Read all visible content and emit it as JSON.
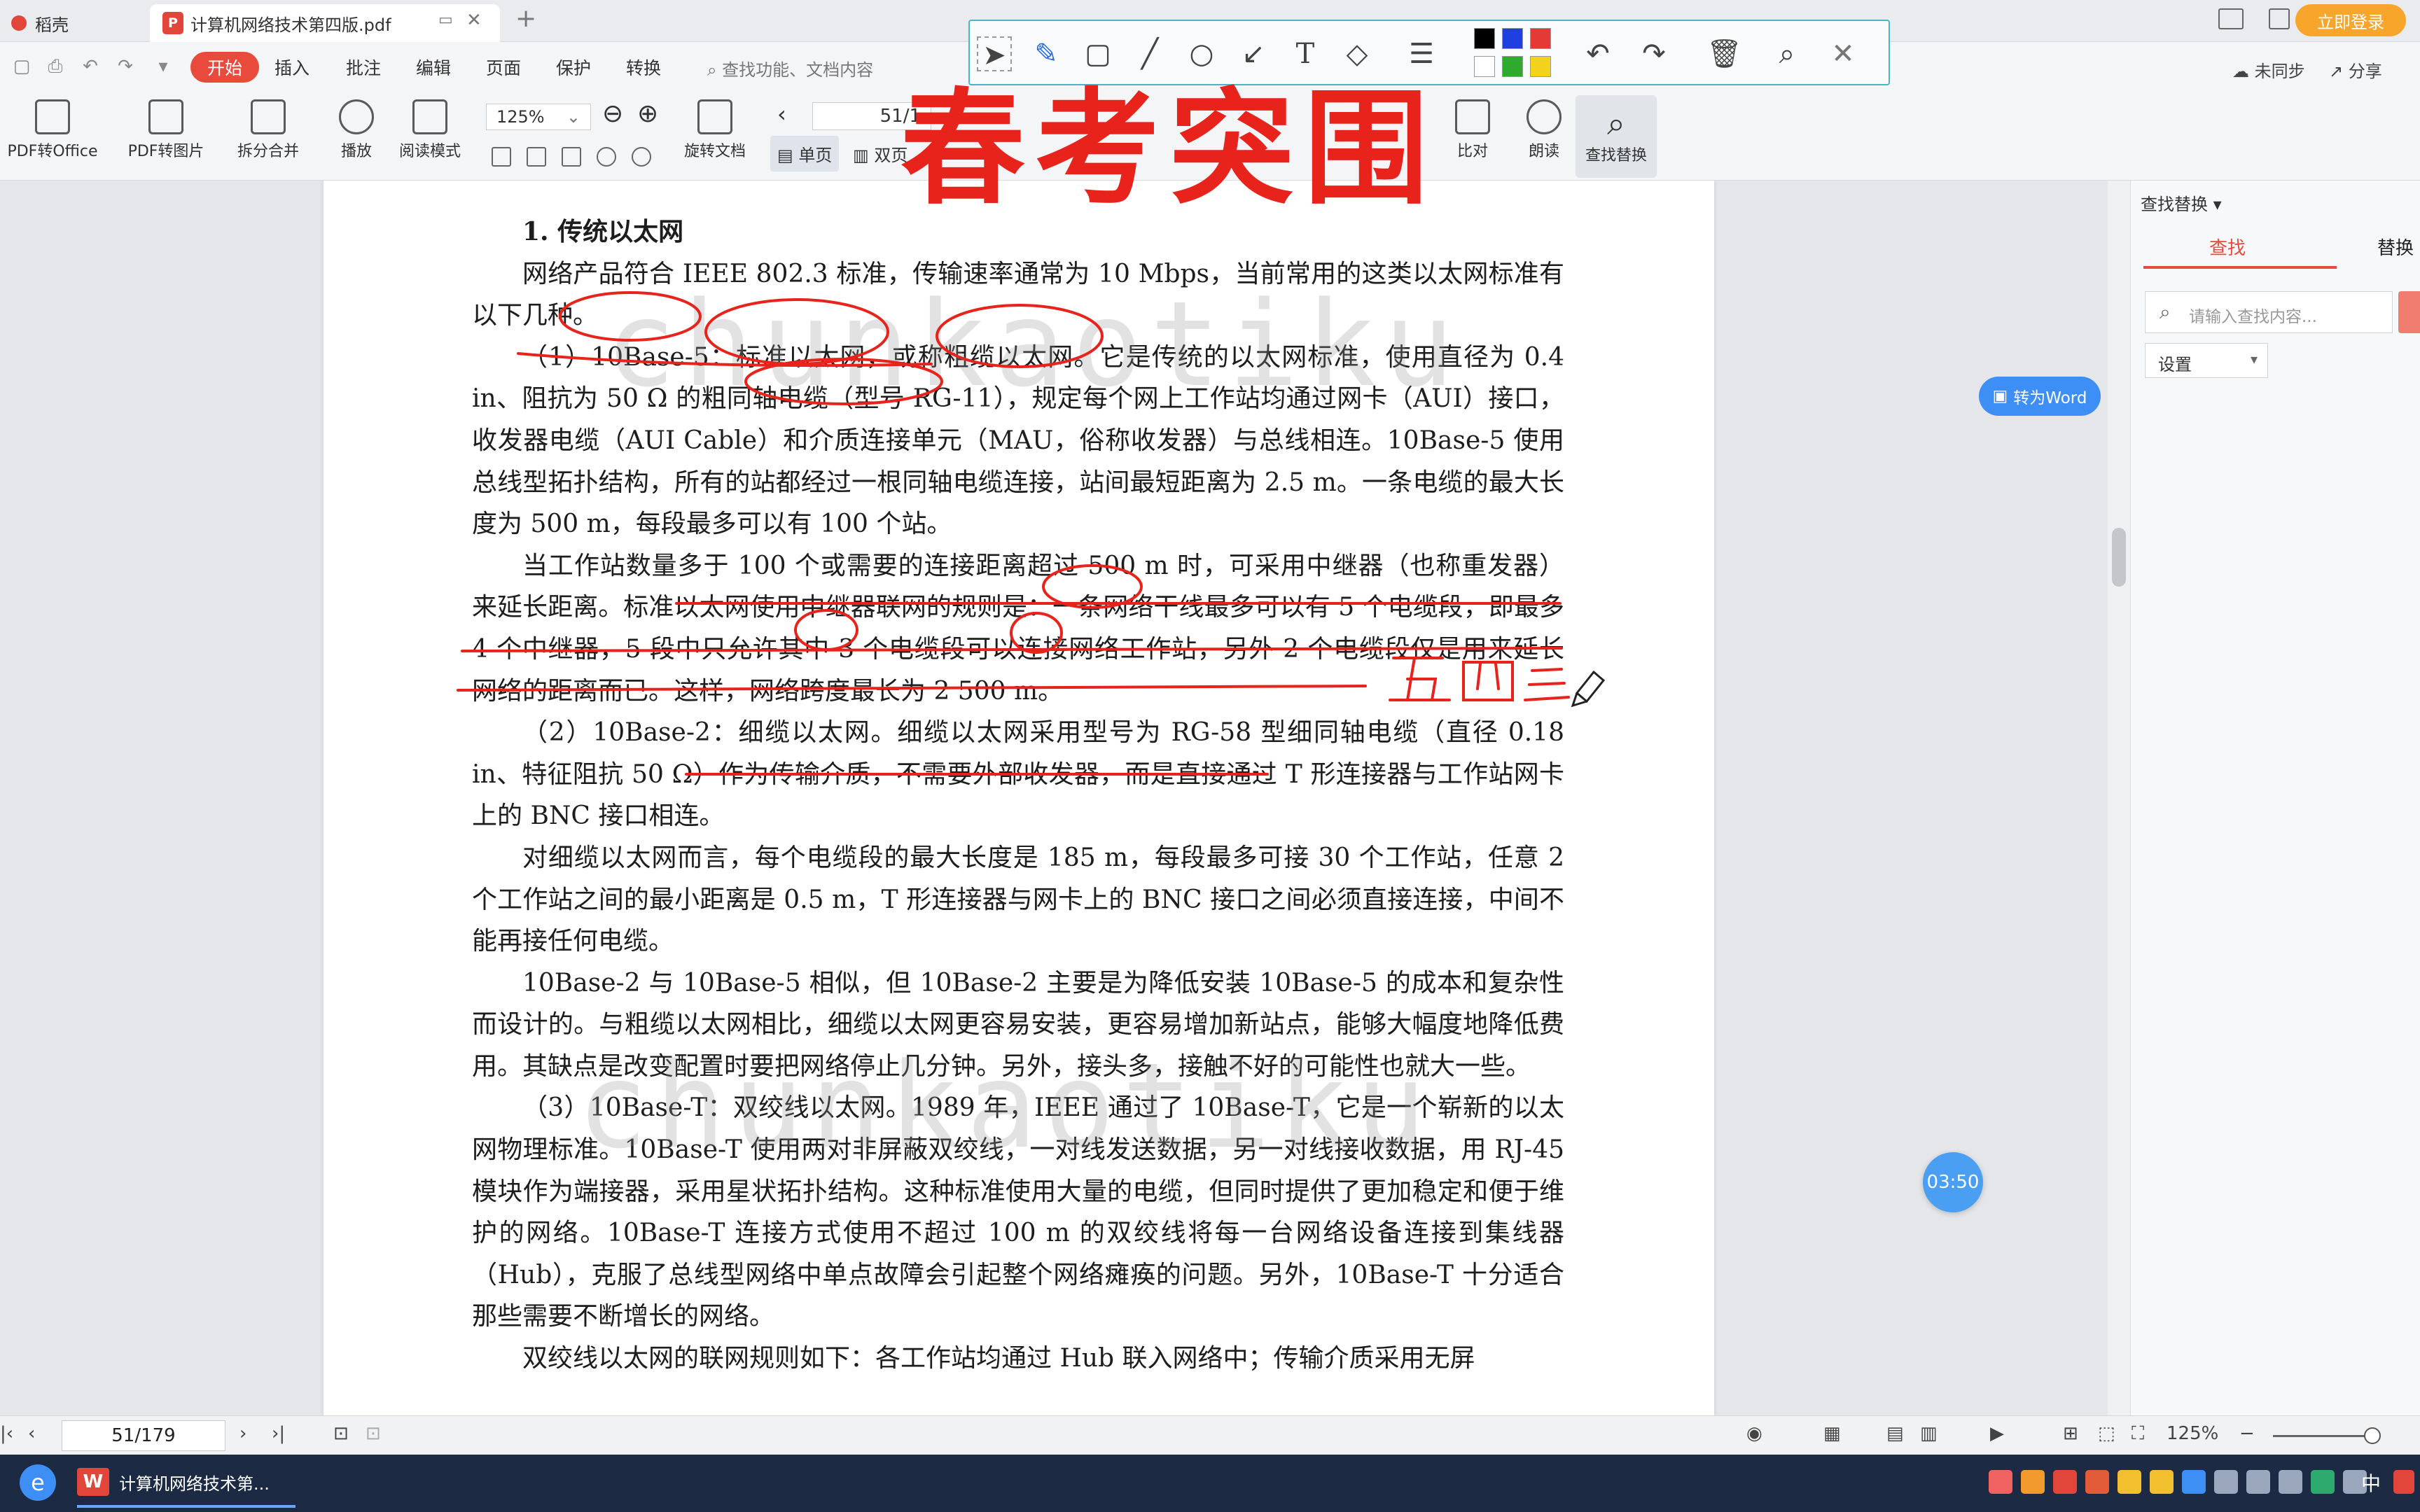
{
  "tabs": {
    "home": "稻壳",
    "doc_title": "计算机网络技术第四版.pdf",
    "close": "✕",
    "new_tab": "+"
  },
  "titlebar": {
    "login": "立即登录"
  },
  "menu": {
    "items": [
      "开始",
      "插入",
      "批注",
      "编辑",
      "页面",
      "保护",
      "转换"
    ],
    "search_placeholder": "查找功能、文档内容",
    "sync": "未同步",
    "share": "分享"
  },
  "ribbon": {
    "pdf_to_office": "PDF转Office",
    "pdf_to_image": "PDF转图片",
    "split_merge": "拆分合并",
    "play": "播放",
    "read_mode": "阅读模式",
    "zoom": "125%",
    "page_field": "51/1",
    "rotate": "旋转文档",
    "single": "单页",
    "double": "双页",
    "compare": "比对",
    "read_aloud": "朗读",
    "find_replace": "查找替换"
  },
  "annotation_colors": [
    "#000000",
    "#1f3fe0",
    "#e53935",
    "#ffffff",
    "#2eaa2e",
    "#f2d21a"
  ],
  "document": {
    "headline": "春考突围",
    "watermark": "chunkaotiku",
    "section_title": "1. 传统以太网",
    "paragraphs": [
      "网络产品符合 IEEE 802.3 标准，传输速率通常为 10 Mbps，当前常用的这类以太网标准有以下几种。",
      "（1）10Base-5：标准以太网，或称粗缆以太网。它是传统的以太网标准，使用直径为 0.4 in、阻抗为 50 Ω 的粗同轴电缆（型号 RG-11），规定每个网上工作站均通过网卡（AUI）接口，收发器电缆（AUI Cable）和介质连接单元（MAU，俗称收发器）与总线相连。10Base-5 使用总线型拓扑结构，所有的站都经过一根同轴电缆连接，站间最短距离为 2.5 m。一条电缆的最大长度为 500 m，每段最多可以有 100 个站。",
      "当工作站数量多于 100 个或需要的连接距离超过 500 m 时，可采用中继器（也称重发器）来延长距离。标准以太网使用中继器联网的规则是：一条网络干线最多可以有 5 个电缆段，即最多 4 个中继器，5 段中只允许其中 3 个电缆段可以连接网络工作站，另外 2 个电缆段仅是用来延长网络的距离而已。这样，网络跨度最长为 2 500 m。",
      "（2）10Base-2：细缆以太网。细缆以太网采用型号为 RG-58 型细同轴电缆（直径 0.18 in、特征阻抗 50 Ω）作为传输介质，不需要外部收发器，而是直接通过 T 形连接器与工作站网卡上的 BNC 接口相连。",
      "对细缆以太网而言，每个电缆段的最大长度是 185 m，每段最多可接 30 个工作站，任意 2 个工作站之间的最小距离是 0.5 m，T 形连接器与网卡上的 BNC 接口之间必须直接连接，中间不能再接任何电缆。",
      "10Base-2 与 10Base-5 相似，但 10Base-2 主要是为降低安装 10Base-5 的成本和复杂性而设计的。与粗缆以太网相比，细缆以太网更容易安装，更容易增加新站点，能够大幅度地降低费用。其缺点是改变配置时要把网络停止几分钟。另外，接头多，接触不好的可能性也就大一些。",
      "（3）10Base-T：双绞线以太网。1989 年，IEEE 通过了 10Base-T，它是一个崭新的以太网物理标准。10Base-T 使用两对非屏蔽双绞线，一对线发送数据，另一对线接收数据，用 RJ-45 模块作为端接器，采用星状拓扑结构。这种标准使用大量的电缆，但同时提供了更加稳定和便于维护的网络。10Base-T 连接方式使用不超过 100 m 的双绞线将每一台网络设备连接到集线器（Hub），克服了总线型网络中单点故障会引起整个网络瘫痪的问题。另外，10Base-T 十分适合那些需要不断增长的网络。",
      "双绞线以太网的联网规则如下：各工作站均通过 Hub 联入网络中；传输介质采用无屏"
    ],
    "handwriting": "五四三"
  },
  "overlay": {
    "to_word": "转为Word",
    "timer": "03:50"
  },
  "right_panel": {
    "title": "查找替换",
    "tab_find": "查找",
    "tab_replace": "替换",
    "search_placeholder": "请输入查找内容...",
    "settings": "设置"
  },
  "status": {
    "page": "51/179",
    "zoom": "125%"
  },
  "taskbar": {
    "app_title": "计算机网络技术第...",
    "ime": "中"
  }
}
